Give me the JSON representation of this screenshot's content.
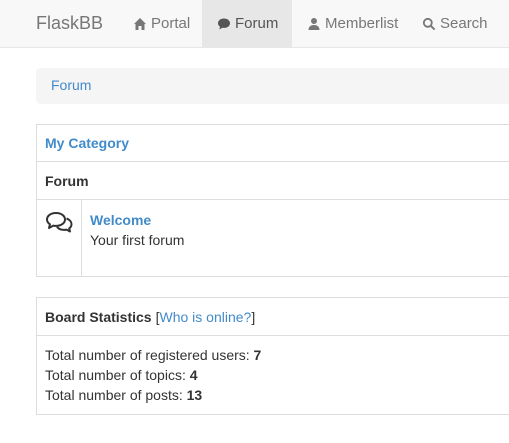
{
  "nav": {
    "brand": "FlaskBB",
    "items": [
      {
        "label": "Portal",
        "icon": "home-icon"
      },
      {
        "label": "Forum",
        "icon": "comment-icon",
        "active": true
      },
      {
        "label": "Memberlist",
        "icon": "user-icon"
      },
      {
        "label": "Search",
        "icon": "search-icon"
      }
    ]
  },
  "breadcrumb": {
    "label": "Forum"
  },
  "category": {
    "title": "My Category",
    "column_header": "Forum",
    "forums": [
      {
        "name": "Welcome",
        "description": "Your first forum",
        "icon": "comments-icon"
      }
    ]
  },
  "stats": {
    "title": "Board Statistics",
    "who_online_link": "Who is online?",
    "bracket_open": "[",
    "bracket_close": "]",
    "lines": [
      {
        "label": "Total number of registered users: ",
        "value": "7"
      },
      {
        "label": "Total number of topics: ",
        "value": "4"
      },
      {
        "label": "Total number of posts: ",
        "value": "13"
      }
    ]
  },
  "colors": {
    "link": "#428bca",
    "navbar_bg": "#f8f8f8",
    "active_nav_bg": "#e7e7e7",
    "border": "#dddddd"
  }
}
